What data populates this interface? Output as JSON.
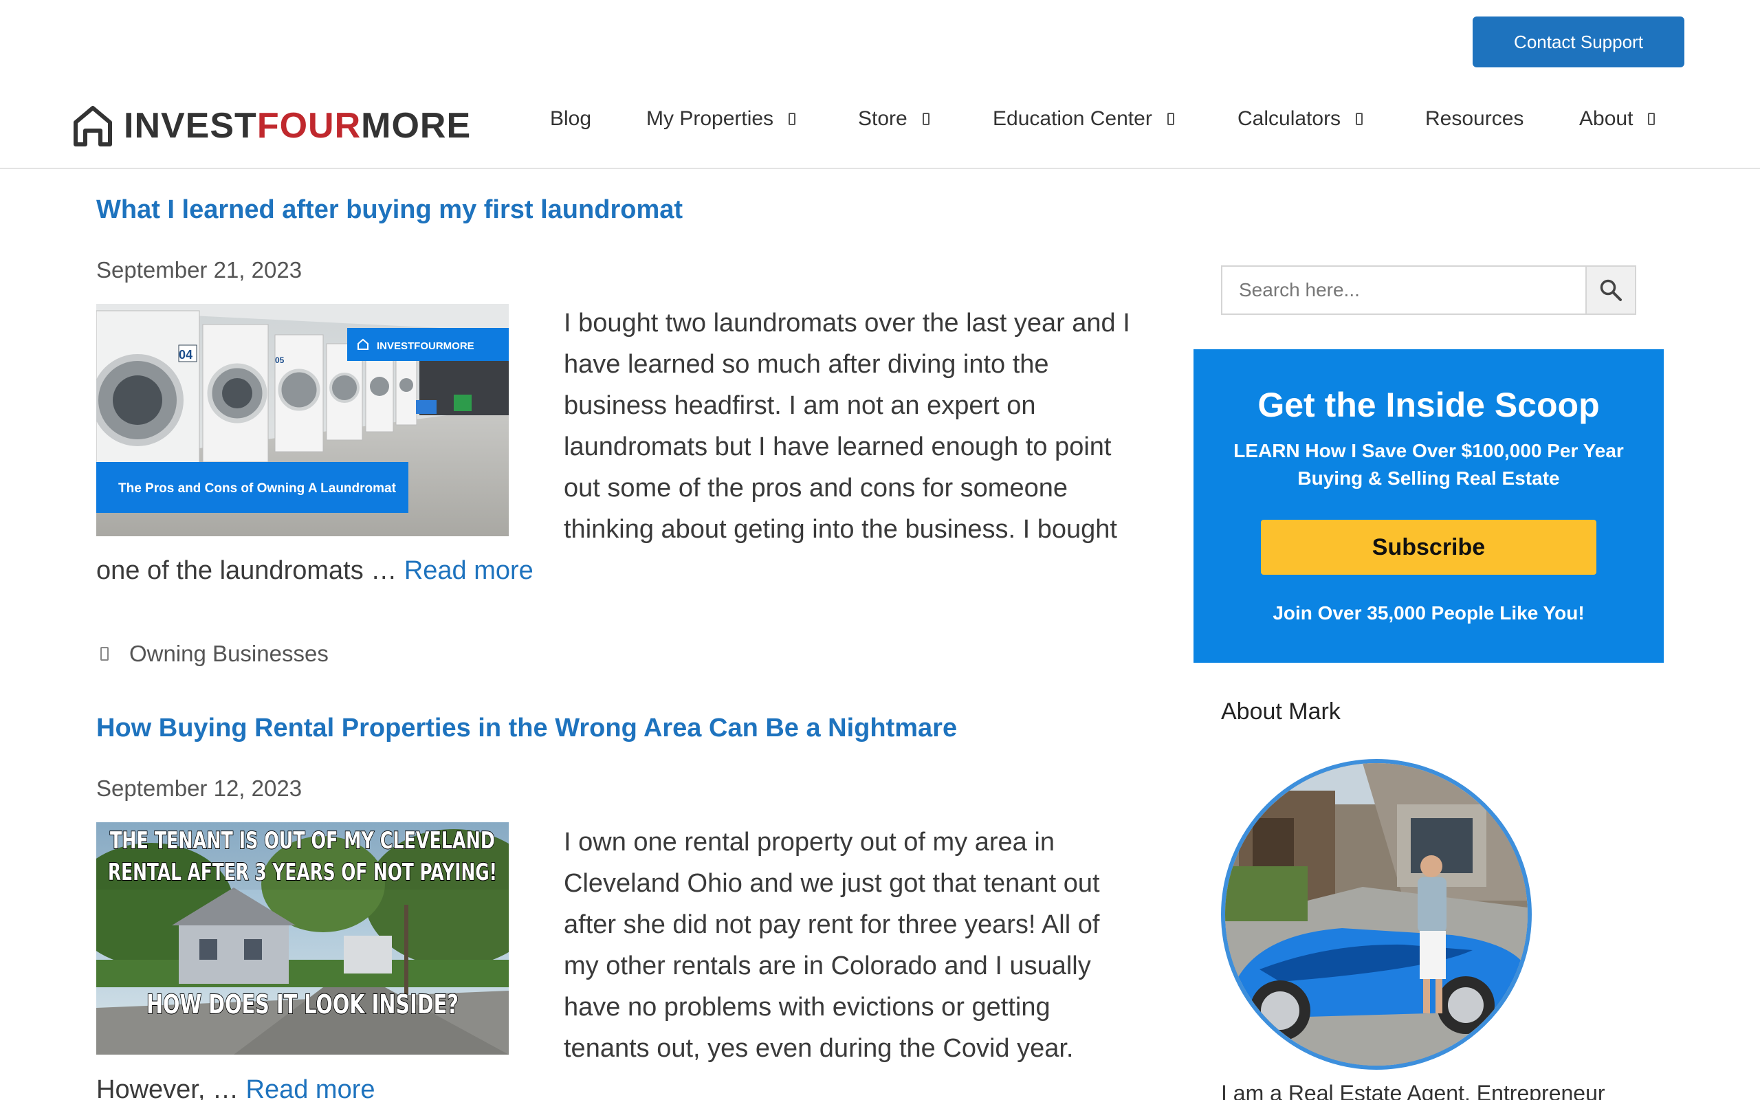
{
  "topbar": {
    "contact_label": "Contact Support"
  },
  "logo": {
    "part1": "INVEST",
    "part2": "FOUR",
    "part3": "MORE"
  },
  "nav": {
    "items": [
      {
        "label": "Blog",
        "has_dropdown": false
      },
      {
        "label": "My Properties",
        "has_dropdown": true
      },
      {
        "label": "Store",
        "has_dropdown": true
      },
      {
        "label": "Education Center",
        "has_dropdown": true
      },
      {
        "label": "Calculators",
        "has_dropdown": true
      },
      {
        "label": "Resources",
        "has_dropdown": false
      },
      {
        "label": "About",
        "has_dropdown": true
      }
    ]
  },
  "posts": [
    {
      "title": "What I learned after buying my first laundromat",
      "date": "September 21, 2023",
      "excerpt": "I bought two laundromats over the last year and I have learned so much after diving into the business headfirst. I am not an expert on laundromats but I have learned enough to point out some of the pros and cons for someone thinking about geting into the business. I bought one of the laundromats … ",
      "read_more": "Read more",
      "category": "Owning Businesses",
      "thumb_badge": "INVESTFOURMORE",
      "thumb_caption": "The Pros and Cons of Owning A Laundromat",
      "thumb_washer_numbers": [
        "04",
        "05"
      ]
    },
    {
      "title": "How Buying Rental Properties in the Wrong Area Can Be a Nightmare",
      "date": "September 12, 2023",
      "excerpt": "I own one rental property out of my area in Cleveland Ohio and we just got that tenant out after she did not pay rent for three years! All of my other rentals are in Colorado and I usually have no problems with evictions or getting tenants out, yes even during the Covid year. However, … ",
      "read_more": "Read more",
      "thumb_line1": "THE TENANT IS OUT OF MY CLEVELAND",
      "thumb_line2": "RENTAL AFTER 3 YEARS OF NOT PAYING!",
      "thumb_line3": "HOW DOES IT LOOK INSIDE?"
    }
  ],
  "sidebar": {
    "search_placeholder": "Search here...",
    "optin": {
      "title": "Get the Inside Scoop",
      "subtitle": "LEARN How I Save Over $100,000 Per Year Buying & Selling Real Estate",
      "button": "Subscribe",
      "footer": "Join Over 35,000 People Like You!"
    },
    "about_title": "About Mark",
    "about_text": "I am a Real Estate Agent, Entrepreneur"
  },
  "colors": {
    "link_blue": "#1e73be",
    "optin_blue": "#0b84e3",
    "subscribe_yellow": "#fcc12d",
    "logo_red": "#c0282d"
  }
}
